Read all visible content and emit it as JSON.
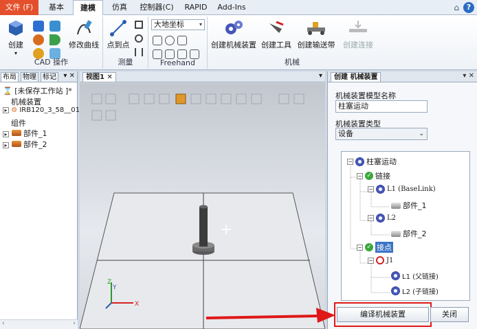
{
  "ribbon": {
    "tabs": [
      {
        "label": "文件 (F)",
        "kind": "file"
      },
      {
        "label": "基本",
        "kind": "normal"
      },
      {
        "label": "建模",
        "kind": "active"
      },
      {
        "label": "仿真",
        "kind": "normal"
      },
      {
        "label": "控制器(C)",
        "kind": "normal"
      },
      {
        "label": "RAPID",
        "kind": "normal"
      },
      {
        "label": "Add-Ins",
        "kind": "normal"
      }
    ],
    "create_label": "创建",
    "modify_curve_label": "修改曲线",
    "cad_group": "CAD 操作",
    "point_to_point_label": "点到点",
    "measure_group": "测量",
    "coord_dropdown": "大地坐标",
    "freehand_group": "Freehand",
    "create_mechanism_label": "创建机械装置",
    "create_tool_label": "创建工具",
    "create_conveyor_label": "创建输送带",
    "create_connection_label": "创建连接",
    "mechanism_group": "机械"
  },
  "left_pane": {
    "tabs": [
      "布局",
      "物理",
      "标记"
    ],
    "station": "[未保存工作站 ]*",
    "mechanisms_header": "机械装置",
    "robot": "IRB120_3_58__01",
    "components_header": "组件",
    "parts": [
      "部件_1",
      "部件_2"
    ]
  },
  "view": {
    "tab": "视图1"
  },
  "right_pane": {
    "tab": "创建 机械装置",
    "model_name_label": "机械装置模型名称",
    "model_name_value": "柱塞运动",
    "type_label": "机械装置类型",
    "type_value": "设备",
    "tree": {
      "root": "柱塞运动",
      "links": "链接",
      "link1": "L1 (BaseLink)",
      "part1": "部件_1",
      "link2": "L2",
      "part2": "部件_2",
      "joints": "接点",
      "joint1": "J1",
      "parent_link": "L1 (父链接)",
      "child_link": "L2 (子链接)"
    },
    "compile_button": "编译机械装置",
    "close_button": "关闭"
  },
  "colors": {
    "file_tab": "#e3502b",
    "highlight": "#3a73c4",
    "annotation_red": "#e01818"
  }
}
